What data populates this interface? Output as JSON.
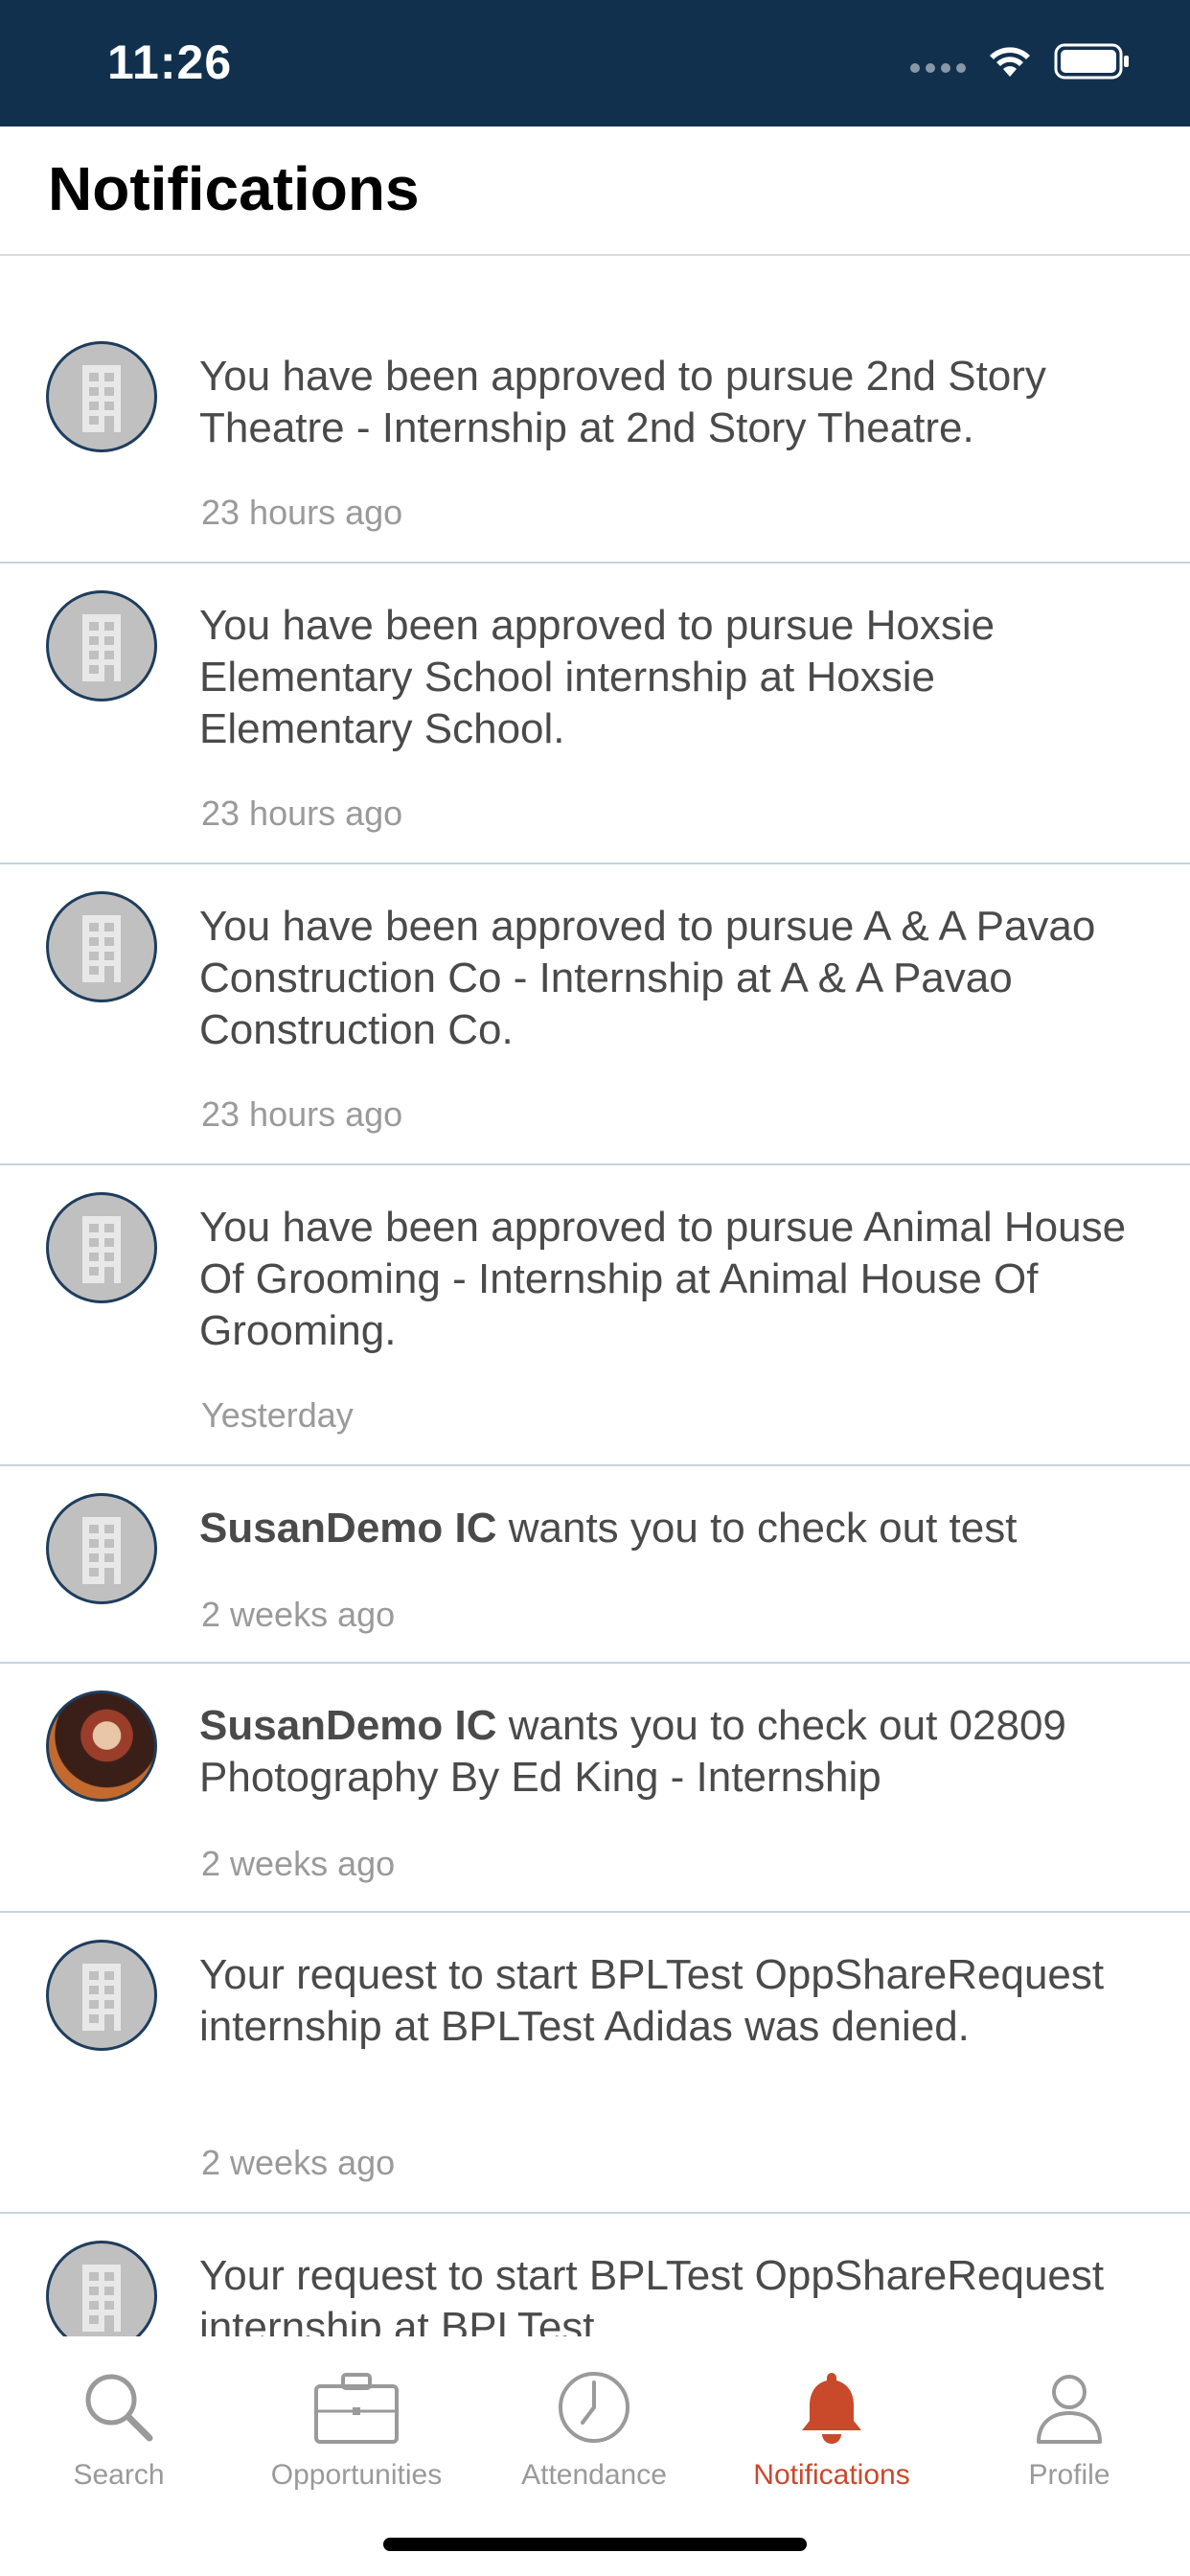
{
  "status_bar": {
    "time": "11:26"
  },
  "header": {
    "title": "Notifications"
  },
  "notifications": [
    {
      "bold": "",
      "text": "You have been approved to pursue 2nd Story Theatre - Internship at 2nd Story Theatre.",
      "time": "23 hours ago",
      "avatar": "building-icon"
    },
    {
      "bold": "",
      "text": "You have been approved to pursue Hoxsie Elementary School internship at Hoxsie Elementary School.",
      "time": "23 hours ago",
      "avatar": "building-icon"
    },
    {
      "bold": "",
      "text": "You have been approved to pursue A & A Pavao Construction Co - Internship at A & A Pavao Construction Co.",
      "time": "23 hours ago",
      "avatar": "building-icon"
    },
    {
      "bold": "",
      "text": "You have been approved to pursue Animal House Of Grooming - Internship at Animal House Of Grooming.",
      "time": "Yesterday",
      "avatar": "building-icon"
    },
    {
      "bold": "SusanDemo IC",
      "text": " wants you to check out test",
      "time": "2 weeks ago",
      "avatar": "building-icon"
    },
    {
      "bold": "SusanDemo IC",
      "text": " wants you to check out 02809 Photography By Ed King - Internship",
      "time": "2 weeks ago",
      "avatar": "user-photo"
    },
    {
      "bold": "",
      "text": "Your request to start BPLTest OppShareRequest internship at BPLTest Adidas was denied.",
      "time": "2 weeks ago",
      "avatar": "building-icon"
    },
    {
      "bold": "",
      "text": "Your request to start BPLTest OppShareRequest internship at BPLTest",
      "time": "",
      "avatar": "building-icon"
    }
  ],
  "tabbar": {
    "search": "Search",
    "opportunities": "Opportunities",
    "attendance": "Attendance",
    "notifications": "Notifications",
    "profile": "Profile",
    "active_color": "#c9492b",
    "inactive_color": "#9a9a9a"
  }
}
